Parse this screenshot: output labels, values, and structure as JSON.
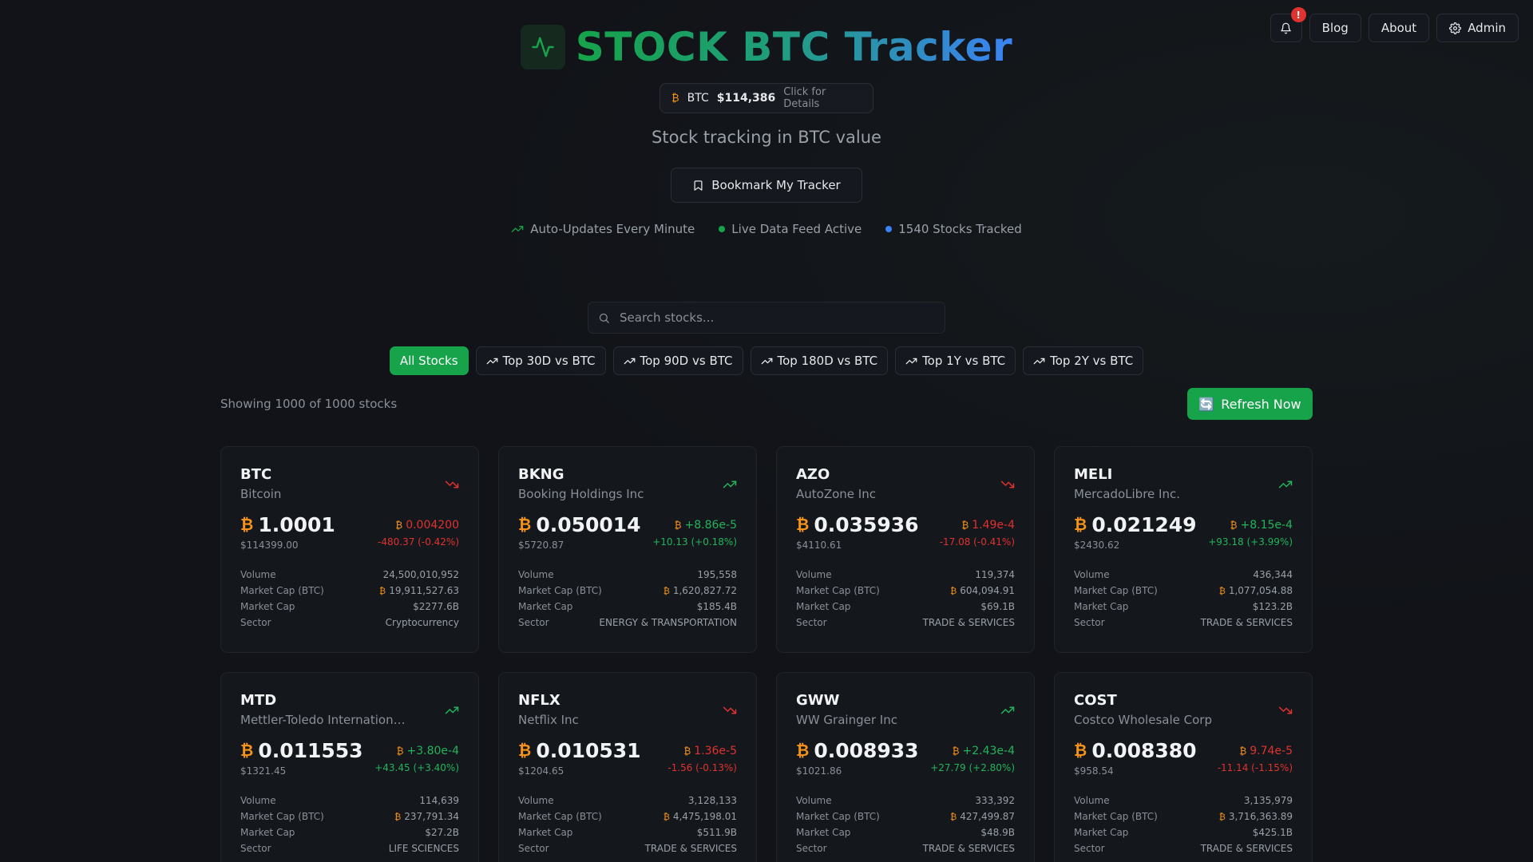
{
  "nav": {
    "notification_badge": "!",
    "blog": "Blog",
    "about": "About",
    "admin": "Admin"
  },
  "header": {
    "title": "STOCK BTC Tracker",
    "btc_label": "BTC",
    "btc_price": "$114,386",
    "btc_hint": "Click for Details",
    "subtitle": "Stock tracking in BTC value",
    "bookmark": "Bookmark My Tracker"
  },
  "status": {
    "auto_updates": "Auto-Updates Every Minute",
    "live_feed": "Live Data Feed Active",
    "tracked": "1540 Stocks Tracked"
  },
  "search": {
    "placeholder": "Search stocks..."
  },
  "filters": [
    "All Stocks",
    "Top 30D vs BTC",
    "Top 90D vs BTC",
    "Top 180D vs BTC",
    "Top 1Y vs BTC",
    "Top 2Y vs BTC"
  ],
  "showing": "Showing 1000 of 1000 stocks",
  "refresh": "Refresh Now",
  "stat_labels": {
    "volume": "Volume",
    "mcap_btc": "Market Cap (BTC)",
    "mcap": "Market Cap",
    "sector": "Sector"
  },
  "colors": {
    "accent": "#16a34a",
    "btc": "#f7931a",
    "up": "#22b45a",
    "down": "#e0322f"
  },
  "cards": [
    {
      "symbol": "BTC",
      "name": "Bitcoin",
      "trend": "down",
      "btc_price": "1.0001",
      "usd": "$114399.00",
      "chg_btc": "0.004200",
      "chg_usd": "-480.37 (-0.42%)",
      "volume": "24,500,010,952",
      "mcap_btc": "19,911,527.63",
      "mcap": "$2277.6B",
      "sector": "Cryptocurrency"
    },
    {
      "symbol": "BKNG",
      "name": "Booking Holdings Inc",
      "trend": "up",
      "btc_price": "0.050014",
      "usd": "$5720.87",
      "chg_btc": "+8.86e-5",
      "chg_usd": "+10.13 (+0.18%)",
      "volume": "195,558",
      "mcap_btc": "1,620,827.72",
      "mcap": "$185.4B",
      "sector": "ENERGY & TRANSPORTATION"
    },
    {
      "symbol": "AZO",
      "name": "AutoZone Inc",
      "trend": "down",
      "btc_price": "0.035936",
      "usd": "$4110.61",
      "chg_btc": "1.49e-4",
      "chg_usd": "-17.08 (-0.41%)",
      "volume": "119,374",
      "mcap_btc": "604,094.91",
      "mcap": "$69.1B",
      "sector": "TRADE & SERVICES"
    },
    {
      "symbol": "MELI",
      "name": "MercadoLibre Inc.",
      "trend": "up",
      "btc_price": "0.021249",
      "usd": "$2430.62",
      "chg_btc": "+8.15e-4",
      "chg_usd": "+93.18 (+3.99%)",
      "volume": "436,344",
      "mcap_btc": "1,077,054.88",
      "mcap": "$123.2B",
      "sector": "TRADE & SERVICES"
    },
    {
      "symbol": "MTD",
      "name": "Mettler-Toledo International Inc",
      "trend": "up",
      "btc_price": "0.011553",
      "usd": "$1321.45",
      "chg_btc": "+3.80e-4",
      "chg_usd": "+43.45 (+3.40%)",
      "volume": "114,639",
      "mcap_btc": "237,791.34",
      "mcap": "$27.2B",
      "sector": "LIFE SCIENCES"
    },
    {
      "symbol": "NFLX",
      "name": "Netflix Inc",
      "trend": "down",
      "btc_price": "0.010531",
      "usd": "$1204.65",
      "chg_btc": "1.36e-5",
      "chg_usd": "-1.56 (-0.13%)",
      "volume": "3,128,133",
      "mcap_btc": "4,475,198.01",
      "mcap": "$511.9B",
      "sector": "TRADE & SERVICES"
    },
    {
      "symbol": "GWW",
      "name": "WW Grainger Inc",
      "trend": "up",
      "btc_price": "0.008933",
      "usd": "$1021.86",
      "chg_btc": "+2.43e-4",
      "chg_usd": "+27.79 (+2.80%)",
      "volume": "333,392",
      "mcap_btc": "427,499.87",
      "mcap": "$48.9B",
      "sector": "TRADE & SERVICES"
    },
    {
      "symbol": "COST",
      "name": "Costco Wholesale Corp",
      "trend": "down",
      "btc_price": "0.008380",
      "usd": "$958.54",
      "chg_btc": "9.74e-5",
      "chg_usd": "-11.14 (-1.15%)",
      "volume": "3,135,979",
      "mcap_btc": "3,716,363.89",
      "mcap": "$425.1B",
      "sector": "TRADE & SERVICES"
    }
  ]
}
